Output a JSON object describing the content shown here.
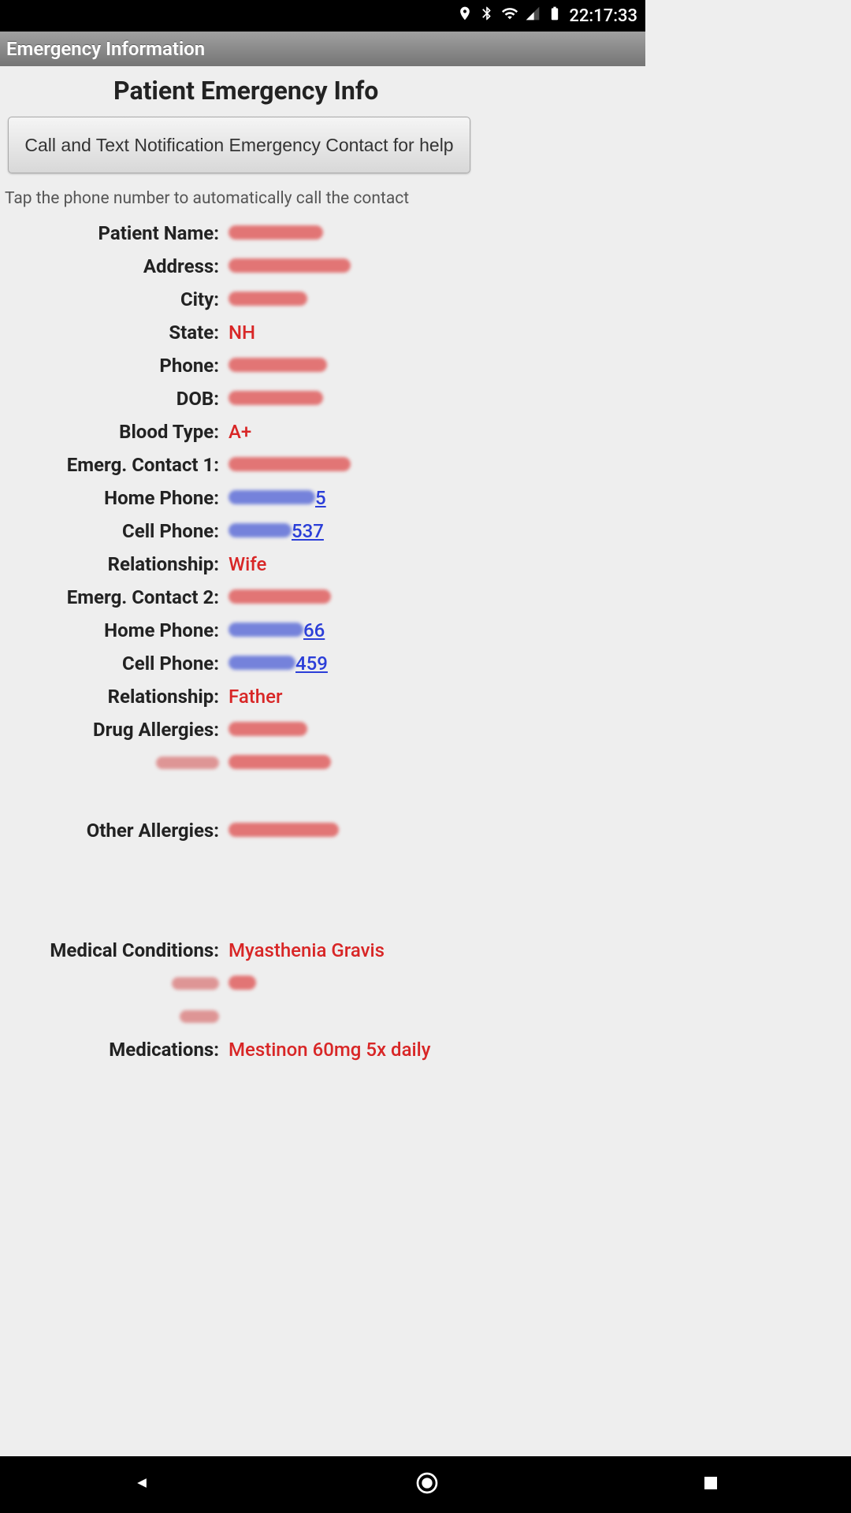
{
  "status": {
    "time": "22:17:33"
  },
  "header": {
    "app_title": "Emergency Information"
  },
  "main": {
    "title": "Patient Emergency Info",
    "call_button": "Call and Text Notification Emergency Contact for help",
    "hint": "Tap the phone number to automatically call the contact"
  },
  "fields": {
    "patient_name_label": "Patient Name:",
    "address_label": "Address:",
    "city_label": "City:",
    "state_label": "State:",
    "state_value": "NH",
    "phone_label": "Phone:",
    "dob_label": "DOB:",
    "blood_label": "Blood Type:",
    "blood_value": "A+",
    "ec1_label": "Emerg. Contact 1:",
    "home_phone_label": "Home Phone:",
    "cell_phone_label": "Cell Phone:",
    "ec1_cell_suffix": "537",
    "relationship_label": "Relationship:",
    "ec1_relationship": "Wife",
    "ec2_label": "Emerg. Contact 2:",
    "ec2_home_suffix": "66",
    "ec2_cell_suffix": "459",
    "ec2_relationship": "Father",
    "drug_allergies_label": "Drug Allergies:",
    "other_allergies_label": "Other Allergies:",
    "medical_conditions_label": "Medical Conditions:",
    "medical_conditions_value": "Myasthenia Gravis",
    "medications_label": "Medications:",
    "medications_value": "Mestinon 60mg 5x daily"
  }
}
